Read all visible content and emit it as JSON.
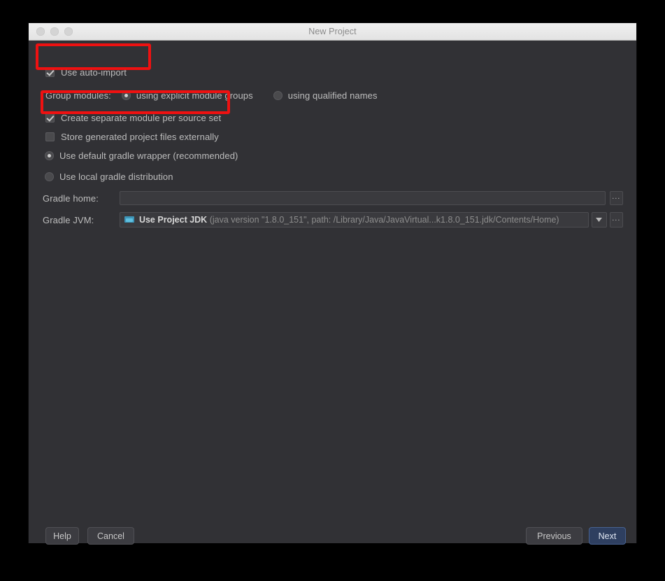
{
  "window": {
    "title": "New Project",
    "traffic_lights": [
      "close-button",
      "minimize-button",
      "zoom-button"
    ]
  },
  "options": {
    "use_auto_import": {
      "label": "Use auto-import",
      "checked": true
    },
    "group_modules": {
      "label": "Group modules:",
      "choices": [
        {
          "label": "using explicit module groups",
          "selected": true
        },
        {
          "label": "using qualified names",
          "selected": false
        }
      ]
    },
    "create_separate_module": {
      "label": "Create separate module per source set",
      "checked": true
    },
    "store_generated_externally": {
      "label": "Store generated project files externally",
      "checked": false
    },
    "gradle_distribution": {
      "choices": [
        {
          "label": "Use default gradle wrapper (recommended)",
          "selected": true
        },
        {
          "label": "Use local gradle distribution",
          "selected": false
        }
      ]
    }
  },
  "fields": {
    "gradle_home": {
      "label": "Gradle home:",
      "value": "",
      "browse_label": "..."
    },
    "gradle_jvm": {
      "label": "Gradle JVM:",
      "icon": "jdk-folder-icon",
      "value_main": "Use Project JDK",
      "value_detail": "(java version \"1.8.0_151\", path: /Library/Java/JavaVirtual...k1.8.0_151.jdk/Contents/Home)",
      "dropdown_label": "▼",
      "browse_label": "..."
    }
  },
  "footer": {
    "help": "Help",
    "cancel": "Cancel",
    "previous": "Previous",
    "next": "Next"
  },
  "annotations": {
    "highlight_color": "#ee1111",
    "boxes": [
      {
        "name": "highlight-use-auto-import"
      },
      {
        "name": "highlight-create-separate-module"
      }
    ]
  }
}
